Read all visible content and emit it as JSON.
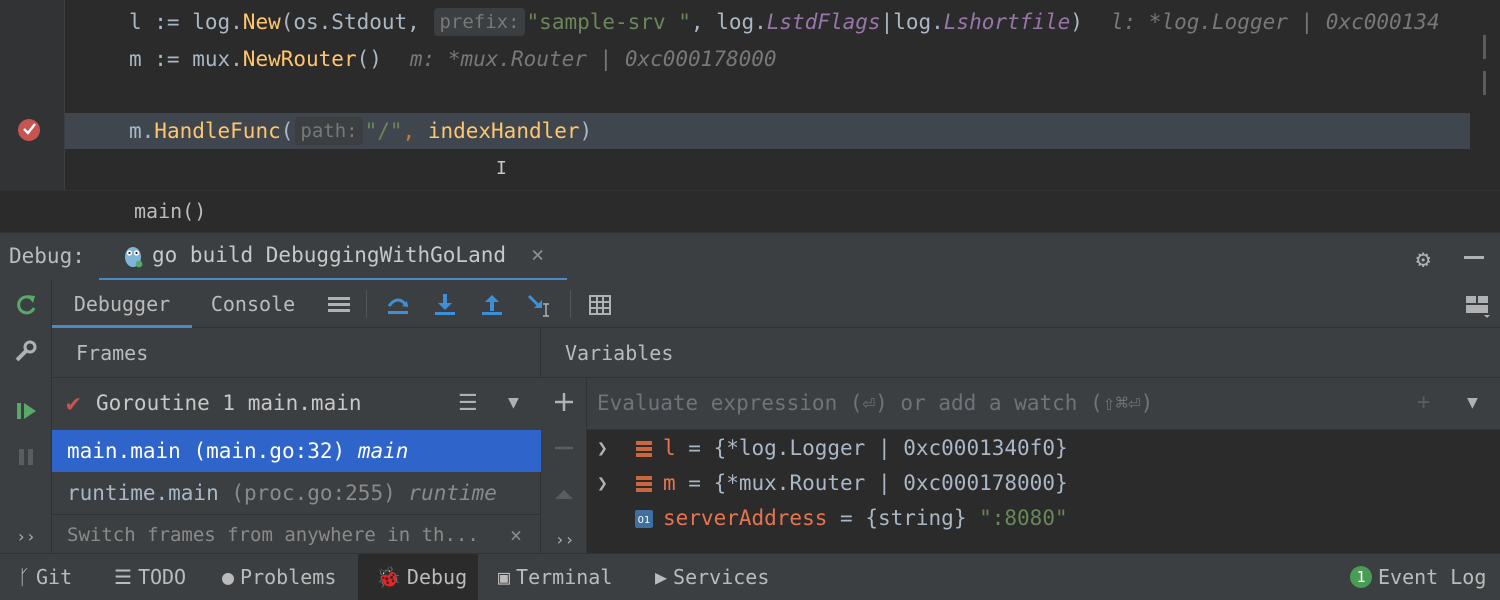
{
  "editor": {
    "line1": {
      "p1": "l := log.",
      "fn1": "New",
      "p2": "(os.Stdout, ",
      "hint": "prefix:",
      "str": "\"sample-srv \"",
      "p3": ", log.",
      "flag1": "LstdFlags",
      "p4": "|log.",
      "flag2": "Lshortfile",
      "p5": ")",
      "inline": "l: *log.Logger | 0xc000134"
    },
    "line2": {
      "p1": "m := mux.",
      "fn1": "NewRouter",
      "p2": "()",
      "inline": "m: *mux.Router | 0xc000178000"
    },
    "line3": {
      "p1": "m.",
      "fn1": "HandleFunc",
      "p2": "(",
      "hint": "path:",
      "str": "\"/\"",
      "p3": ", ",
      "arg": "indexHandler",
      "p4": ")"
    }
  },
  "breadcrumb": "main()",
  "debug_header": {
    "label": "Debug:",
    "run_config": "go build DebuggingWithGoLand",
    "close": "×"
  },
  "tabs": {
    "debugger": "Debugger",
    "console": "Console"
  },
  "frames": {
    "title": "Frames",
    "goroutine": "Goroutine 1 main.main",
    "rows": [
      {
        "func": "main.main",
        "loc": "(main.go:32)",
        "pkg": "main",
        "selected": true
      },
      {
        "func": "runtime.main",
        "loc": "(proc.go:255)",
        "pkg": "runtime",
        "selected": false
      }
    ],
    "hint": "Switch frames from anywhere in th...",
    "hint_close": "×"
  },
  "variables": {
    "title": "Variables",
    "placeholder": "Evaluate expression (⏎) or add a watch (⇧⌘⏎)",
    "rows": [
      {
        "name": "l",
        "eq": " = ",
        "value": "{*log.Logger | 0xc0001340f0}",
        "expandable": true,
        "icon": "struct-icon"
      },
      {
        "name": "m",
        "eq": " = ",
        "value": "{*mux.Router | 0xc000178000}",
        "expandable": true,
        "icon": "struct-icon"
      },
      {
        "name": "serverAddress",
        "eq": " = ",
        "type": "{string} ",
        "str": "\":8080\"",
        "expandable": false,
        "icon": "string-icon"
      }
    ]
  },
  "statusbar": {
    "git": "Git",
    "todo": "TODO",
    "problems": "Problems",
    "debug": "Debug",
    "terminal": "Terminal",
    "services": "Services",
    "event_count": "1",
    "event_log": "Event Log"
  },
  "colors": {
    "accent": "#4a88c7",
    "selection": "#2f65ca",
    "breakpoint": "#c75450",
    "string": "#6a8759",
    "function": "#ffc66d",
    "var_name": "#e8744f"
  }
}
